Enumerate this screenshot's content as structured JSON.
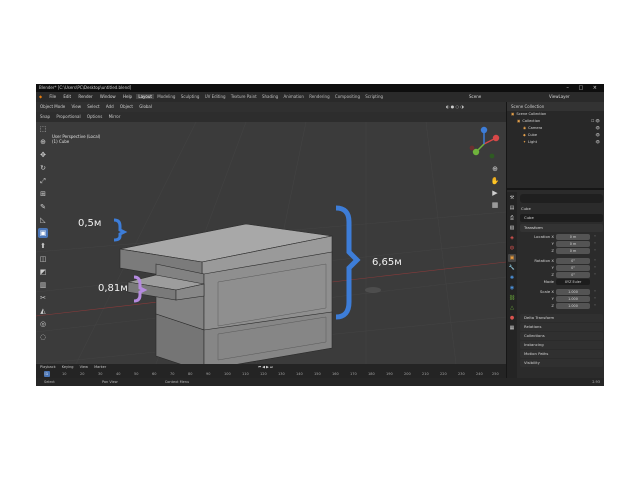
{
  "window": {
    "title": "Blender* [C:\\Users\\PC\\Desktop\\untitled.blend]",
    "controls": "–  □  ×"
  },
  "menubar": {
    "items": [
      "File",
      "Edit",
      "Render",
      "Window",
      "Help"
    ],
    "workspaces": [
      "Layout",
      "Modeling",
      "Sculpting",
      "UV Editing",
      "Texture Paint",
      "Shading",
      "Animation",
      "Rendering",
      "Compositing",
      "Scripting"
    ],
    "active_workspace": "Layout",
    "scene_label": "Scene",
    "view_layer_label": "ViewLayer"
  },
  "viewport": {
    "header": [
      "Object Mode",
      "View",
      "Select",
      "Add",
      "Object",
      "Global"
    ],
    "header2": [
      "Snap",
      "Proportional",
      "Options",
      "Mirror"
    ],
    "mode_info_line1": "User Perspective (Local)",
    "mode_info_line2": "(1) Cube",
    "annotations": {
      "top_thickness": "0,5м",
      "gap_height": "0,81м",
      "total_height": "6,65м"
    },
    "colors": {
      "bracket": "#3d7dd8",
      "background": "#3b3b3b",
      "model": "#8e8e8e"
    }
  },
  "toolbar": {
    "tools": [
      "select-box",
      "cursor",
      "move",
      "rotate",
      "scale",
      "transform",
      "annotate",
      "measure",
      "add-cube",
      "extrude",
      "inset",
      "bevel",
      "loop-cut",
      "knife",
      "poly-build",
      "spin",
      "smooth",
      "edge-slide",
      "shrink",
      "shear",
      "rip"
    ]
  },
  "timeline": {
    "items": [
      "Playback",
      "Keying",
      "View",
      "Marker"
    ],
    "current_frame": "1",
    "ticks": [
      "0",
      "10",
      "20",
      "30",
      "40",
      "50",
      "60",
      "70",
      "80",
      "90",
      "100",
      "110",
      "120",
      "130",
      "140",
      "150",
      "160",
      "170",
      "180",
      "190",
      "200",
      "210",
      "220",
      "230",
      "240",
      "250"
    ]
  },
  "statusbar": {
    "items": [
      "Select",
      "Pan View",
      "Context Menu"
    ],
    "version": "2.93"
  },
  "outliner": {
    "header": "Scene Collection",
    "rows": [
      {
        "label": "Scene Collection",
        "indent": 0,
        "icon": "▣"
      },
      {
        "label": "Collection",
        "indent": 1,
        "icon": "▣"
      },
      {
        "label": "Camera",
        "indent": 2,
        "icon": "◉"
      },
      {
        "label": "Cube",
        "indent": 2,
        "icon": "◆"
      },
      {
        "label": "Light",
        "indent": 2,
        "icon": "✦"
      }
    ]
  },
  "properties": {
    "object_label": "Cube",
    "object_name": "Cube",
    "transform_section": "Transform",
    "location": [
      {
        "label": "Location X",
        "value": "0 m"
      },
      {
        "label": "Y",
        "value": "0 m"
      },
      {
        "label": "Z",
        "value": "0 m"
      }
    ],
    "rotation": [
      {
        "label": "Rotation X",
        "value": "0°"
      },
      {
        "label": "Y",
        "value": "0°"
      },
      {
        "label": "Z",
        "value": "0°"
      }
    ],
    "mode": {
      "label": "Mode",
      "value": "XYZ Euler"
    },
    "scale": [
      {
        "label": "Scale X",
        "value": "1.000"
      },
      {
        "label": "Y",
        "value": "1.000"
      },
      {
        "label": "Z",
        "value": "1.000"
      }
    ],
    "collapsed": [
      "Delta Transform",
      "Relations",
      "Collections",
      "Instancing",
      "Motion Paths",
      "Visibility"
    ]
  }
}
